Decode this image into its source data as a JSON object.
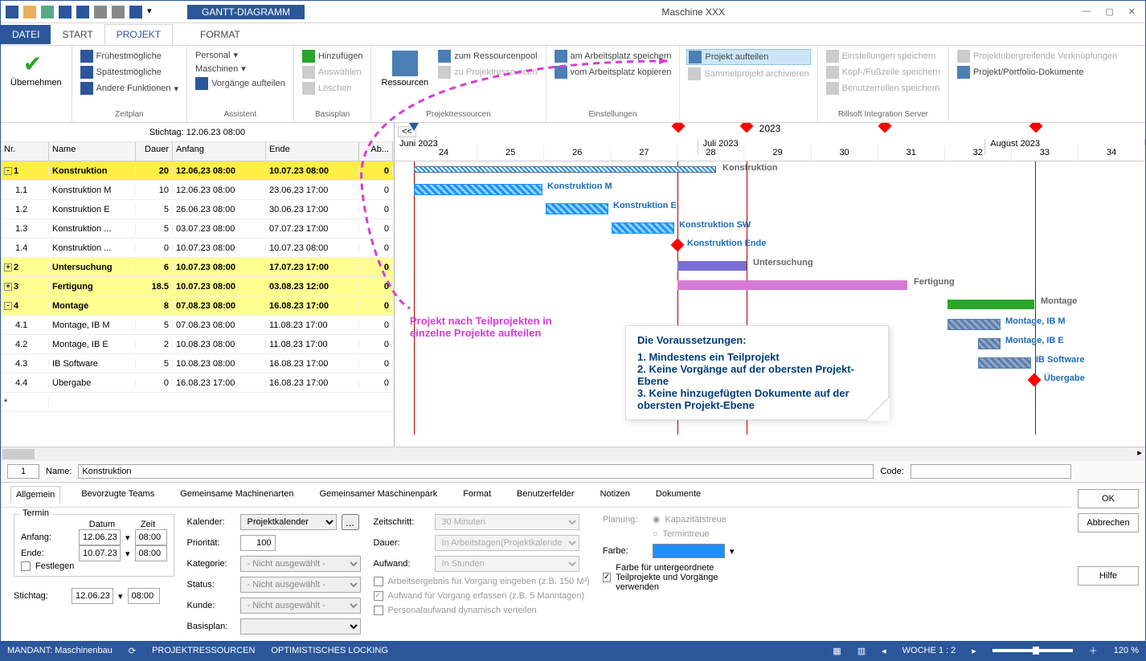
{
  "titlebar": {
    "contextual": "GANTT-DIAGRAMM",
    "title": "Maschine XXX"
  },
  "tabs": {
    "file": "DATEI",
    "start": "START",
    "projekt": "PROJEKT",
    "format": "FORMAT"
  },
  "ribbon": {
    "uebernehmen": "Übernehmen",
    "zeitplan": {
      "fruh": "Frühestmögliche",
      "spat": "Spätestmögliche",
      "andere": "Andere Funktionen",
      "label": "Zeitplan"
    },
    "assistent": {
      "personal": "Personal",
      "maschinen": "Maschinen",
      "vorgange": "Vorgänge aufteilen",
      "label": "Assistent"
    },
    "basisplan": {
      "hinzu": "Hinzufügen",
      "auswahl": "Auswählen",
      "loeschen": "Löschen",
      "label": "Basisplan"
    },
    "projres": {
      "res": "Ressourcen",
      "zum": "zum Ressourcenpool",
      "zup": "zu Projektressourcen",
      "label": "Projektressourcen"
    },
    "einst": {
      "am": "am Arbeitsplatz speichern",
      "vom": "vom Arbeitsplatz kopieren",
      "label": "Einstellungen"
    },
    "split": "Projekt aufteilen",
    "sammel": "Sammelprojekt archivieren",
    "ris": {
      "einst": "Einstellungen speichern",
      "kopf": "Kopf-/Fußzeile speichern",
      "benutzer": "Benutzerrollen speichern",
      "label": "Rillsoft Integration Server"
    },
    "right": {
      "verk": "Projektübergreifende Verknüpfungen",
      "dok": "Projekt/Portfolio-Dokumente"
    }
  },
  "stichtag_label": "Stichtag: 12.06.23 08:00",
  "backbtn": "<<",
  "gridcols": {
    "nr": "Nr.",
    "name": "Name",
    "dauer": "Dauer",
    "anfang": "Anfang",
    "ende": "Ende",
    "ab": "Ab..."
  },
  "rows": [
    {
      "nr": "1",
      "name": "Konstruktion",
      "dauer": "20",
      "anf": "12.06.23 08:00",
      "ende": "10.07.23 08:00",
      "ab": "0",
      "sum": true,
      "first": true,
      "exp": "-"
    },
    {
      "nr": "1.1",
      "name": "Konstruktion M",
      "dauer": "10",
      "anf": "12.06.23 08:00",
      "ende": "23.06.23 17:00",
      "ab": "0"
    },
    {
      "nr": "1.2",
      "name": "Konstruktion E",
      "dauer": "5",
      "anf": "26.06.23 08:00",
      "ende": "30.06.23 17:00",
      "ab": "0"
    },
    {
      "nr": "1.3",
      "name": "Konstruktion ...",
      "dauer": "5",
      "anf": "03.07.23 08:00",
      "ende": "07.07.23 17:00",
      "ab": "0"
    },
    {
      "nr": "1.4",
      "name": "Konstruktion ...",
      "dauer": "0",
      "anf": "10.07.23 08:00",
      "ende": "10.07.23 08:00",
      "ab": "0"
    },
    {
      "nr": "2",
      "name": "Untersuchung",
      "dauer": "6",
      "anf": "10.07.23 08:00",
      "ende": "17.07.23 17:00",
      "ab": "0",
      "sum": true,
      "exp": "+"
    },
    {
      "nr": "3",
      "name": "Fertigung",
      "dauer": "18.5",
      "anf": "10.07.23 08:00",
      "ende": "03.08.23 12:00",
      "ab": "0",
      "sum": true,
      "exp": "+"
    },
    {
      "nr": "4",
      "name": "Montage",
      "dauer": "8",
      "anf": "07.08.23 08:00",
      "ende": "16.08.23 17:00",
      "ab": "0",
      "sum": true,
      "exp": "-"
    },
    {
      "nr": "4.1",
      "name": "Montage, IB M",
      "dauer": "5",
      "anf": "07.08.23 08:00",
      "ende": "11.08.23 17:00",
      "ab": "0"
    },
    {
      "nr": "4.2",
      "name": "Montage, IB E",
      "dauer": "2",
      "anf": "10.08.23 08:00",
      "ende": "11.08.23 17:00",
      "ab": "0"
    },
    {
      "nr": "4.3",
      "name": "IB Software",
      "dauer": "5",
      "anf": "10.08.23 08:00",
      "ende": "16.08.23 17:00",
      "ab": "0"
    },
    {
      "nr": "4.4",
      "name": "Übergabe",
      "dauer": "0",
      "anf": "16.08.23 17:00",
      "ende": "16.08.23 17:00",
      "ab": "0"
    }
  ],
  "asterisk": "*",
  "timeline": {
    "year": "2023",
    "months": [
      "Juni 2023",
      "Juli 2023",
      "August 2023"
    ],
    "weeks": [
      "24",
      "25",
      "26",
      "27",
      "28",
      "29",
      "30",
      "31",
      "32",
      "33",
      "34"
    ]
  },
  "barlabels": {
    "konstruktion": "Konstruktion",
    "km": "Konstruktion M",
    "ke": "Konstruktion E",
    "ksw": "Konstruktion SW",
    "kend": "Konstruktion Ende",
    "unt": "Untersuchung",
    "fert": "Fertigung",
    "mont": "Montage",
    "mm": "Montage, IB M",
    "me": "Montage, IB E",
    "ibsw": "IB Software",
    "ueb": "Übergabe"
  },
  "annot1_a": "Projekt nach Teilprojekten in",
  "annot1_b": "einzelne Projekte aufteilen",
  "annot2": {
    "t": "Die Voraussetzungen:",
    "l1": "1. Mindestens ein Teilprojekt",
    "l2": "2. Keine Vorgänge auf der obersten Projekt-Ebene",
    "l3": "3. Keine hinzugefügten Dokumente auf der obersten Projekt-Ebene"
  },
  "detailbar": {
    "idx": "1",
    "name_lbl": "Name:",
    "name_val": "Konstruktion",
    "code_lbl": "Code:",
    "code_val": ""
  },
  "dtabs": [
    "Allgemein",
    "Bevorzugte Teams",
    "Gemeinsame Machinenarten",
    "Gemeinsamer Maschinenpark",
    "Format",
    "Benutzerfelder",
    "Notizen",
    "Dokumente"
  ],
  "term": {
    "legend": "Termin",
    "datum": "Datum",
    "zeit": "Zeit",
    "anfang": "Anfang:",
    "ende": "Ende:",
    "anf_d": "12.06.23",
    "anf_t": "08:00",
    "end_d": "10.07.23",
    "end_t": "08:00",
    "fest": "Festlegen",
    "stichtag": "Stichtag:",
    "st_d": "12.06.23",
    "st_t": "08:00"
  },
  "props": {
    "kal": "Kalender:",
    "kal_v": "Projektkalender",
    "prio": "Priorität:",
    "prio_v": "100",
    "kat": "Kategorie:",
    "not_sel": "- Nicht ausgewählt -",
    "status": "Status:",
    "kunde": "Kunde:",
    "basis": "Basisplan:"
  },
  "mid": {
    "zs": "Zeitschritt:",
    "zs_v": "30 Minuten",
    "dauer": "Dauer:",
    "dauer_v": "In Arbeitstagen(Projektkalender abh",
    "auf": "Aufwand:",
    "auf_v": "In Stunden",
    "cb1": "Arbeitsergebnis für Vorgang eingeben (z.B. 150 M³)",
    "cb2": "Aufwand für Vorgang erfassen (z.B. 5 Manntagen)",
    "cb3": "Personalaufwand dynamisch verteilen"
  },
  "right": {
    "plan": "Planung:",
    "kap": "Kapazitätstreue",
    "term": "Termintreue",
    "farbe": "Farbe:",
    "cb4": "Farbe für untergeordnete Teilprojekte und Vorgänge verwenden"
  },
  "btns": {
    "ok": "OK",
    "abbr": "Abbrechen",
    "hilfe": "Hilfe"
  },
  "status": {
    "mandant": "MANDANT: Maschinenbau",
    "pr": "PROJEKTRESSOURCEN",
    "ol": "OPTIMISTISCHES LOCKING",
    "woche": "WOCHE 1 : 2",
    "zoom": "120 %"
  }
}
